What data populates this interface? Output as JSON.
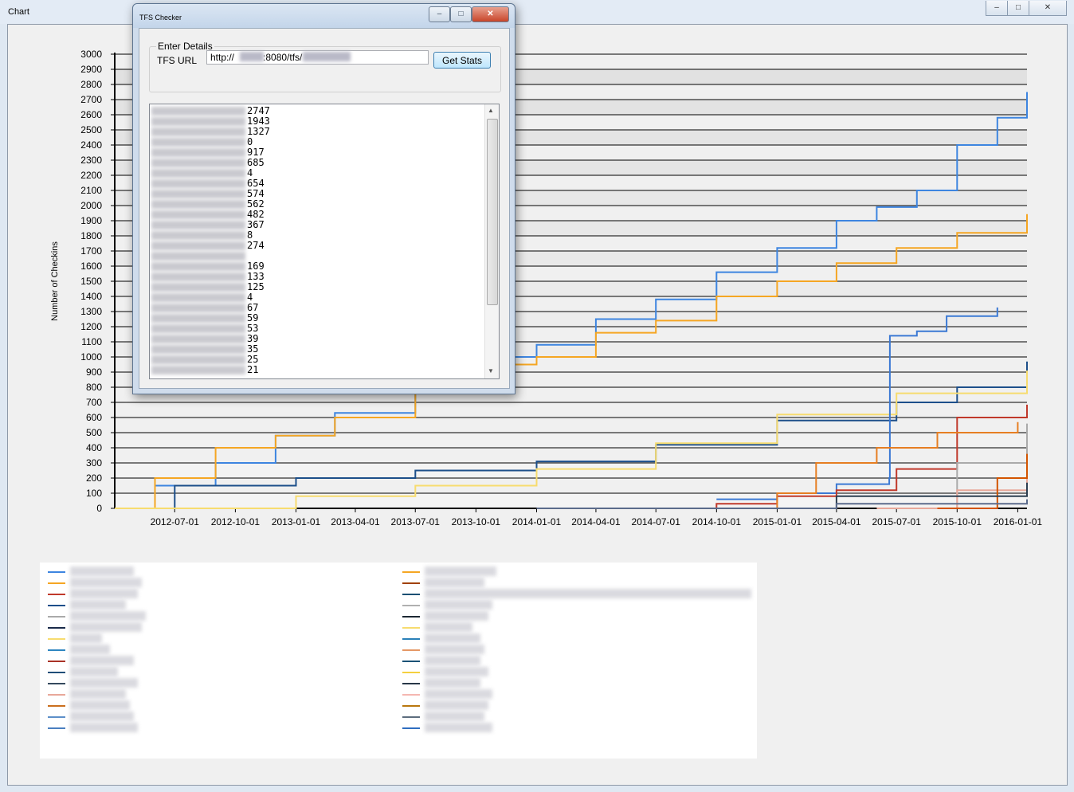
{
  "chart_window": {
    "title": "Chart",
    "controls": [
      "–",
      "□",
      "✕"
    ]
  },
  "chart_data": {
    "type": "line",
    "ylabel": "Number of Checkins",
    "xlabel": "",
    "ylim": [
      0,
      3000
    ],
    "y_ticks": [
      0,
      100,
      200,
      300,
      400,
      500,
      600,
      700,
      800,
      900,
      1000,
      1100,
      1200,
      1300,
      1400,
      1500,
      1600,
      1700,
      1800,
      1900,
      2000,
      2100,
      2200,
      2300,
      2400,
      2500,
      2600,
      2700,
      2800,
      2900,
      3000
    ],
    "x_range": [
      "2012-04-01",
      "2016-01-15"
    ],
    "x_ticks": [
      "2012-07-01",
      "2012-10-01",
      "2013-01-01",
      "2013-04-01",
      "2013-07-01",
      "2013-10-01",
      "2014-01-01",
      "2014-04-01",
      "2014-07-01",
      "2014-10-01",
      "2015-01-01",
      "2015-04-01",
      "2015-07-01",
      "2015-10-01",
      "2016-01-01"
    ],
    "grid": true,
    "series": [
      {
        "color": "#3d85e0",
        "x": [
          "2012-04-01",
          "2012-06-01",
          "2012-09-01",
          "2012-12-01",
          "2013-03-01",
          "2013-07-01",
          "2013-10-01",
          "2014-01-01",
          "2014-04-01",
          "2014-07-01",
          "2014-10-01",
          "2015-01-01",
          "2015-04-01",
          "2015-06-01",
          "2015-08-01",
          "2015-10-01",
          "2015-12-01",
          "2016-01-15"
        ],
        "y": [
          0,
          150,
          300,
          480,
          630,
          820,
          1000,
          1080,
          1250,
          1380,
          1560,
          1720,
          1900,
          1990,
          2100,
          2400,
          2580,
          2750
        ]
      },
      {
        "color": "#f5a623",
        "x": [
          "2012-04-01",
          "2012-06-01",
          "2012-09-01",
          "2012-12-01",
          "2013-03-01",
          "2013-07-01",
          "2013-10-01",
          "2014-01-01",
          "2014-04-01",
          "2014-07-01",
          "2014-10-01",
          "2015-01-01",
          "2015-04-01",
          "2015-07-01",
          "2015-10-01",
          "2016-01-15"
        ],
        "y": [
          0,
          200,
          400,
          480,
          600,
          800,
          950,
          1000,
          1160,
          1240,
          1400,
          1500,
          1620,
          1720,
          1820,
          1943
        ]
      },
      {
        "color": "#1d4f8a",
        "x": [
          "2012-04-01",
          "2012-07-01",
          "2013-01-01",
          "2013-07-01",
          "2014-01-01",
          "2014-07-01",
          "2015-01-01",
          "2015-07-01",
          "2015-10-01",
          "2016-01-15"
        ],
        "y": [
          0,
          150,
          200,
          250,
          310,
          420,
          580,
          700,
          800,
          970
        ]
      },
      {
        "color": "#f7dc6f",
        "x": [
          "2012-04-01",
          "2013-01-01",
          "2013-07-01",
          "2014-01-01",
          "2014-07-01",
          "2015-01-01",
          "2015-07-01",
          "2016-01-15"
        ],
        "y": [
          0,
          80,
          150,
          260,
          430,
          620,
          760,
          910
        ]
      },
      {
        "color": "#3b79d4",
        "x": [
          "2014-10-01",
          "2015-01-01",
          "2015-04-01",
          "2015-06-20",
          "2015-06-21",
          "2015-08-01",
          "2015-09-15",
          "2015-12-01"
        ],
        "y": [
          60,
          100,
          160,
          200,
          1140,
          1170,
          1270,
          1327
        ]
      },
      {
        "color": "#c0392b",
        "x": [
          "2014-04-01",
          "2014-10-01",
          "2015-01-01",
          "2015-04-01",
          "2015-07-01",
          "2015-10-01",
          "2016-01-15"
        ],
        "y": [
          0,
          30,
          80,
          120,
          260,
          600,
          685
        ]
      },
      {
        "color": "#e67e22",
        "x": [
          "2014-11-01",
          "2015-01-01",
          "2015-03-01",
          "2015-06-01",
          "2015-09-01",
          "2016-01-01"
        ],
        "y": [
          0,
          100,
          300,
          400,
          500,
          570
        ]
      },
      {
        "color": "#aaaaaa",
        "x": [
          "2015-07-01",
          "2015-10-01",
          "2016-01-15"
        ],
        "y": [
          0,
          300,
          560
        ]
      },
      {
        "color": "#e8a89a",
        "x": [
          "2015-06-01",
          "2015-10-01",
          "2016-01-15"
        ],
        "y": [
          0,
          120,
          270
        ]
      },
      {
        "color": "#d35400",
        "x": [
          "2015-09-01",
          "2015-12-01",
          "2016-01-15"
        ],
        "y": [
          0,
          200,
          360
        ]
      },
      {
        "color": "#2c3e50",
        "x": [
          "2014-09-01",
          "2015-04-01",
          "2016-01-15"
        ],
        "y": [
          0,
          80,
          170
        ]
      },
      {
        "color": "#5b6b8b",
        "x": [
          "2014-01-01",
          "2015-04-01",
          "2016-01-15"
        ],
        "y": [
          0,
          30,
          60
        ]
      }
    ],
    "legend_colors": [
      [
        "#3d85e0",
        "#f5a623",
        "#c0392b",
        "#1d4f8a",
        "#aaaaaa",
        "#1a2a4a",
        "#f7dc6f",
        "#2e86c1",
        "#a93226",
        "#1f4e79",
        "#34495e",
        "#e8a89a",
        "#ca6f1e",
        "#5d8fc9",
        "#4a7fc0"
      ],
      [
        "#f5a623",
        "#a04000",
        "#1b4f72",
        "#b0b0b0",
        "#1c2833",
        "#f7dc6f",
        "#2980b9",
        "#e59866",
        "#1a5276",
        "#f4d03f",
        "#283747",
        "#f5b7b1",
        "#b9770e",
        "#5d6d7e",
        "#2e6dc0"
      ]
    ]
  },
  "tfs_dialog": {
    "title": "TFS Checker",
    "controls": [
      "–",
      "□",
      "✕"
    ],
    "group_label": "Enter Details",
    "url_label": "TFS URL",
    "url_value": "http://   :8080/tfs/",
    "get_stats_label": "Get Stats",
    "results": [
      "2747",
      "1943",
      "1327",
      "0",
      "917",
      "685",
      "4",
      "654",
      "574",
      "562",
      "482",
      "367",
      "8",
      "274",
      "",
      "169",
      "133",
      "125",
      "4",
      "67",
      "59",
      "53",
      "39",
      "35",
      "25",
      "21"
    ]
  }
}
